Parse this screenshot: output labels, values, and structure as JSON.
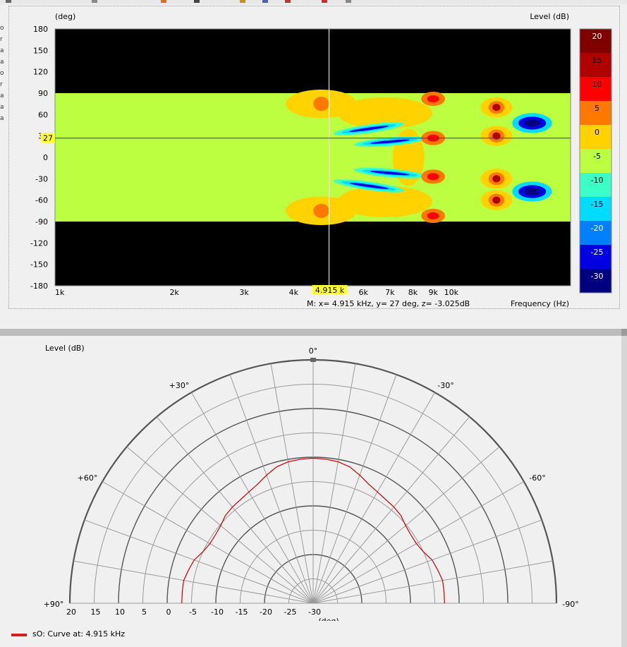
{
  "window": {
    "left_edge_chars": [
      "o",
      "r",
      "a",
      "a",
      "o",
      "r",
      "a",
      "a",
      "a"
    ]
  },
  "heatmap_panel": {
    "y_unit_label": "(deg)",
    "z_unit_label": "Level  (dB)",
    "x_axis_label": "Frequency  (Hz)",
    "marker_x_flag": "4.915 k",
    "marker_y_flag": "27",
    "marker_readout": "M:  x= 4.915 kHz,  y= 27 deg, z= -3.025dB"
  },
  "polar_panel": {
    "level_label": "Level  (dB)",
    "radial_unit_label": "(deg)",
    "center_mark": "o",
    "angle_labels": {
      "top": "0°",
      "left_30": "+30°",
      "right_30": "-30°",
      "left_60": "+60°",
      "right_60": "-60°",
      "left_90": "+90°",
      "right_90": "-90°"
    },
    "legend_label": "sO: Curve at: 4.915 kHz"
  },
  "chart_data": [
    {
      "type": "heatmap",
      "title": "",
      "xlabel": "Frequency  (Hz)",
      "ylabel": "(deg)",
      "colorbar_label": "Level  (dB)",
      "x_scale": "log",
      "xlim": [
        1000,
        20000
      ],
      "ylim": [
        -180,
        180
      ],
      "x_ticks": [
        1000,
        2000,
        3000,
        4000,
        6000,
        7000,
        8000,
        9000,
        10000
      ],
      "x_tick_labels": [
        "1k",
        "2k",
        "3k",
        "4k",
        "6k",
        "7k",
        "8k",
        "9k",
        "10k"
      ],
      "y_ticks": [
        180,
        150,
        120,
        90,
        60,
        30,
        0,
        -30,
        -60,
        -90,
        -120,
        -150,
        -180
      ],
      "y_tick_labels": [
        "180",
        "150",
        "120",
        "90",
        "60",
        "30",
        "0",
        "-30",
        "-60",
        "-90",
        "-120",
        "-150",
        "-180"
      ],
      "colorbar_ticks": [
        20,
        15,
        10,
        5,
        0,
        -5,
        -10,
        -15,
        -20,
        -25,
        -30
      ],
      "colorbar_colors": [
        "#800000",
        "#b00000",
        "#ff0000",
        "#ff7800",
        "#ffd200",
        "#bcff40",
        "#3cffc8",
        "#00dcff",
        "#0080ff",
        "#0000e0",
        "#000080"
      ],
      "colors": {
        "below_min": "#000000"
      },
      "marker": {
        "x_khz": 4.915,
        "y_deg": 27,
        "z_db": -3.025
      }
    },
    {
      "type": "line",
      "subtype": "polar",
      "title": "",
      "series": [
        {
          "name": "sO: Curve at: 4.915 kHz",
          "color": "#cc0000",
          "angles_deg": [
            90,
            85,
            80,
            75,
            70,
            65,
            60,
            55,
            50,
            45,
            40,
            35,
            30,
            25,
            20,
            15,
            10,
            5,
            0,
            -5,
            -10,
            -15,
            -20,
            -25,
            -30,
            -35,
            -40,
            -45,
            -50,
            -55,
            -60,
            -65,
            -70,
            -75,
            -80,
            -85,
            -90
          ],
          "levels_db": [
            -3,
            -3,
            -3,
            -3.5,
            -4,
            -5,
            -5.5,
            -5.5,
            -5.2,
            -4.5,
            -4.2,
            -4,
            -3.6,
            -3,
            -2,
            -1,
            -0.5,
            -0.3,
            -0.2,
            -0.3,
            -0.5,
            -1,
            -2,
            -3,
            -3.6,
            -4,
            -4.2,
            -4.5,
            -5.2,
            -5.5,
            -5.5,
            -5,
            -4,
            -3.5,
            -3,
            -3,
            -3
          ]
        }
      ],
      "radial_range_db": [
        -30,
        20
      ],
      "radial_ticks": [
        20,
        15,
        10,
        5,
        0,
        -5,
        -10,
        -15,
        -20,
        -25,
        -30
      ],
      "radial_tick_labels": [
        "20",
        "15",
        "10",
        "5",
        "0",
        "-5",
        "-10",
        "-15",
        "-20",
        "-25",
        "-30"
      ],
      "angle_range_deg": [
        -90,
        90
      ],
      "angle_step_deg": 10
    }
  ]
}
